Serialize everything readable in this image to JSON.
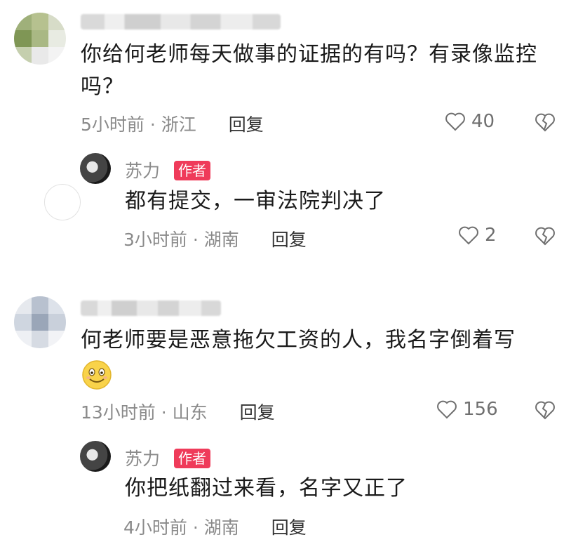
{
  "comments": [
    {
      "text": "你给何老师每天做事的证据的有吗？有录像监控吗？",
      "time": "5小时前",
      "location": "浙江",
      "reply_label": "回复",
      "likes": "40",
      "reply": {
        "author": "苏力",
        "badge": "作者",
        "text": "都有提交，一审法院判决了",
        "time": "3小时前",
        "location": "湖南",
        "reply_label": "回复",
        "likes": "2"
      }
    },
    {
      "text": "何老师要是恶意拖欠工资的人，我名字倒着写",
      "time": "13小时前",
      "location": "山东",
      "reply_label": "回复",
      "likes": "156",
      "reply": {
        "author": "苏力",
        "badge": "作者",
        "text": "你把纸翻过来看，名字又正了",
        "time": "4小时前",
        "location": "湖南",
        "reply_label": "回复"
      }
    }
  ],
  "icons": {
    "like": "heart-outline-icon",
    "dislike": "broken-heart-icon",
    "emoji": "smiling-face-emoji"
  },
  "colors": {
    "badge": "#ef3b5a",
    "meta": "#8a8a8a"
  }
}
